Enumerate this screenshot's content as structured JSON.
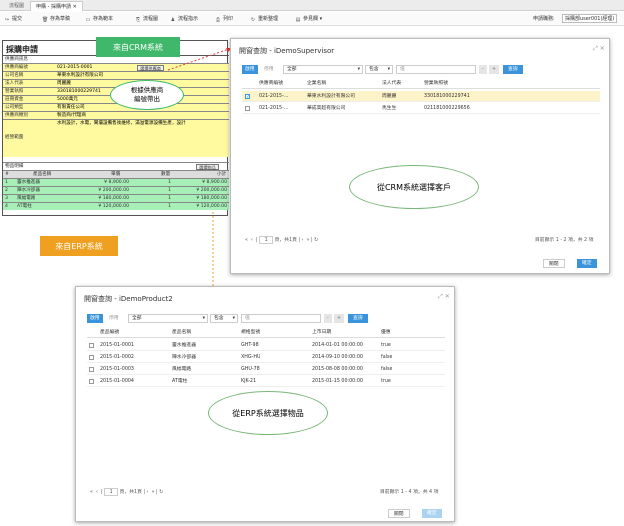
{
  "tabs": [
    "流程圖",
    "申購 - 採購申請"
  ],
  "toolbar": {
    "items": [
      "提交",
      "存為草稿",
      "存為範本",
      "流程圖",
      "流程指示",
      "列印",
      "重新整理",
      "參見欄"
    ],
    "applicant_label": "申請職務:",
    "applicant_value": "採購部user001(經理)"
  },
  "form": {
    "title": "採購申請",
    "section_supplier": "供應商訊息",
    "fields": [
      {
        "label": "供應商編號",
        "value": "021-2015-0001"
      },
      {
        "label": "公司名稱",
        "value": "華東水利設計有限公司"
      },
      {
        "label": "法人代表",
        "value": "周麗麗"
      },
      {
        "label": "營業執照",
        "value": "330181000229741"
      },
      {
        "label": "註冊資金",
        "value": "5000萬元"
      },
      {
        "label": "公司類型",
        "value": "有限責任公司"
      },
      {
        "label": "供應商類別",
        "value": "製造商/代理商"
      },
      {
        "label": "經營範圍",
        "value": "水利設計，水電，閘壩設備售後維修，滿溢電源設備生產，設計"
      }
    ],
    "select_supplier_button": "選擇供應商",
    "goods_label": "物品明細",
    "select_goods_button": "選擇物品",
    "table_headers": [
      "#",
      "產品名稱",
      "單價",
      "數量",
      "小計"
    ],
    "rows": [
      {
        "no": "1",
        "name": "靈水推進器",
        "price": "¥ 8,900.00",
        "qty": "1",
        "total": "¥ 8,900.00"
      },
      {
        "no": "2",
        "name": "陣水冷卻器",
        "price": "¥ 200,000.00",
        "qty": "1",
        "total": "¥ 200,000.00"
      },
      {
        "no": "3",
        "name": "風幅電路",
        "price": "¥ 180,000.00",
        "qty": "1",
        "total": "¥ 180,000.00"
      },
      {
        "no": "4",
        "name": "AT電柱",
        "price": "¥ 120,000.00",
        "qty": "1",
        "total": "¥ 120,000.00"
      }
    ]
  },
  "annotations": {
    "crm": "來自CRM系統",
    "auto": "根據供應商\n編號帶出",
    "erp": "來自ERP系統",
    "cloud_crm": "從CRM系統選擇客戶",
    "cloud_erp": "從ERP系統選擇物品"
  },
  "dialog1": {
    "title": "開窗查詢 - iDemoSupervisor",
    "filter_on": "啟用",
    "filter_off": "停用",
    "field_select": "全部",
    "op_select": "包含",
    "value_placeholder": "值",
    "minus": "-",
    "plus": "+",
    "query": "查詢",
    "headers": [
      "供應商編號",
      "企業名稱",
      "法人代表",
      "營業執照號"
    ],
    "rows": [
      {
        "checked": true,
        "c1": "021-2015-...",
        "c2": "華東水利設計有限公司",
        "c3": "周麗麗",
        "c4": "330181000229741"
      },
      {
        "checked": false,
        "c1": "021-2015-...",
        "c2": "華成高超有限公司",
        "c3": "馬生生",
        "c4": "021181000229656"
      }
    ],
    "page_label": "頁，共1頁",
    "page_value": "1",
    "status": "目前顯示 1 - 2 項，共 2 項",
    "close": "關閉",
    "confirm": "確定"
  },
  "dialog2": {
    "title": "開窗查詢 - iDemoProduct2",
    "filter_on": "啟用",
    "filter_off": "停用",
    "field_select": "全部",
    "op_select": "包含",
    "value_placeholder": "值",
    "minus": "-",
    "plus": "+",
    "query": "查詢",
    "headers": [
      "產品編號",
      "產品名稱",
      "規格型號",
      "上市日期",
      "優惠"
    ],
    "rows": [
      {
        "c1": "2015-01-0001",
        "c2": "靈水推進器",
        "c3": "GHT-98",
        "c4": "2014-01-01 00:00:00",
        "c5": "true"
      },
      {
        "c1": "2015-01-0002",
        "c2": "陣水冷卻器",
        "c3": "XHG-HU",
        "c4": "2014-09-10 00:00:00",
        "c5": "false"
      },
      {
        "c1": "2015-01-0003",
        "c2": "風幅電路",
        "c3": "GHU-78",
        "c4": "2015-08-08 00:00:00",
        "c5": "false"
      },
      {
        "c1": "2015-01-0004",
        "c2": "AT電柱",
        "c3": "KJK-21",
        "c4": "2015-01-15 00:00:00",
        "c5": "true"
      }
    ],
    "page_label": "頁，共1頁",
    "page_value": "1",
    "status": "目前顯示 1 - 4 項，共 4 項",
    "close": "關閉",
    "confirm": "確定"
  },
  "colors": {
    "accent": "#3a94db",
    "form_yellow": "#fff9a0",
    "form_green": "#a6f0b8",
    "callout_green": "#3fb86c",
    "callout_orange": "#f0a020"
  }
}
